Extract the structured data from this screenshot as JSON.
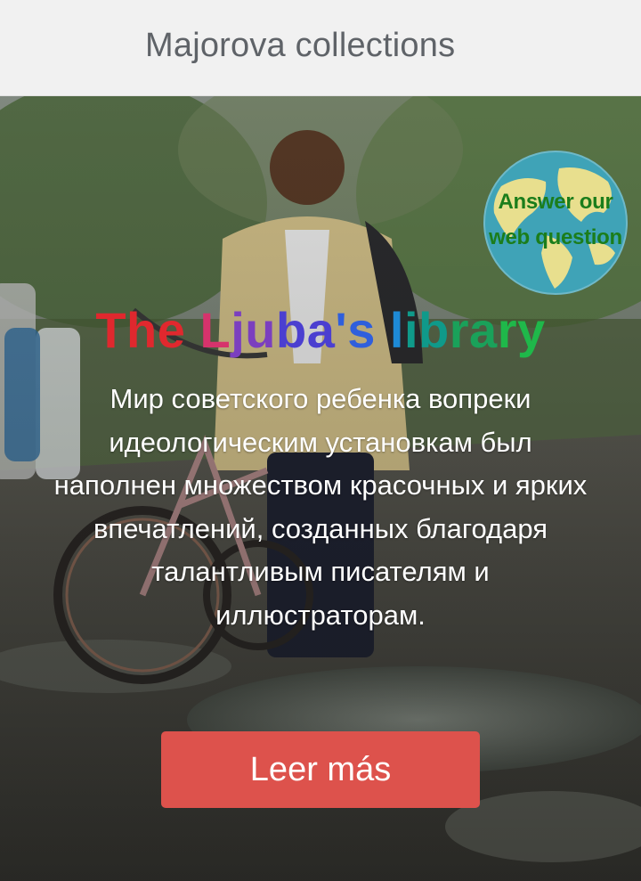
{
  "header": {
    "site_title": "Majorova collections"
  },
  "badge": {
    "icon": "globe-icon",
    "line1": "Answer our",
    "line2": "web question"
  },
  "hero": {
    "title": "The Ljuba's library",
    "title_colors": [
      "#e0282e",
      "#d6336c",
      "#7b3fbf",
      "#4b3fd0",
      "#2f5fdc",
      "#1e8ad6",
      "#0f9a8a",
      "#1aa15a",
      "#1fb84a"
    ],
    "description": "Мир советского ребенка вопреки идеологическим установкам был наполнен множеством красочных и ярких впечатлений, созданных благодаря талантливым писателям и иллюстраторам.",
    "button_label": "Leer más",
    "button_color": "#dd524c"
  }
}
